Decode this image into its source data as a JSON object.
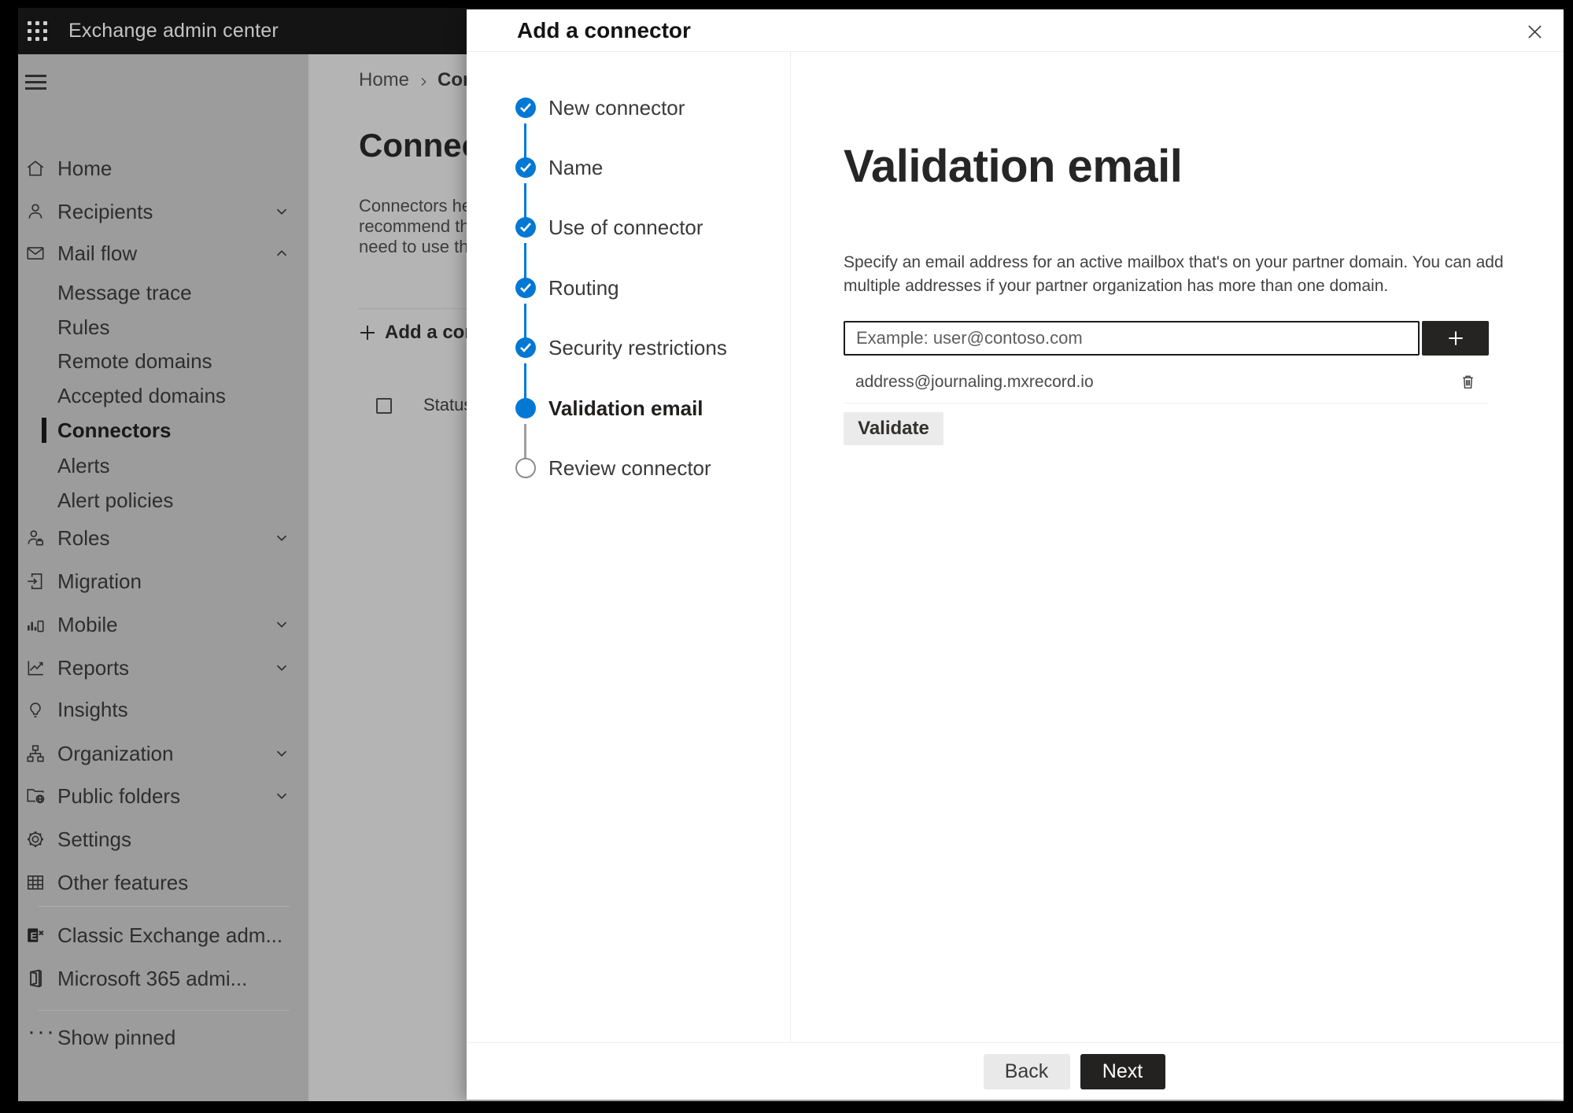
{
  "topbar": {
    "app_title": "Exchange admin center"
  },
  "sidebar": {
    "items": [
      {
        "label": "Home"
      },
      {
        "label": "Recipients"
      },
      {
        "label": "Mail flow"
      },
      {
        "label": "Message trace"
      },
      {
        "label": "Rules"
      },
      {
        "label": "Remote domains"
      },
      {
        "label": "Accepted domains"
      },
      {
        "label": "Connectors"
      },
      {
        "label": "Alerts"
      },
      {
        "label": "Alert policies"
      },
      {
        "label": "Roles"
      },
      {
        "label": "Migration"
      },
      {
        "label": "Mobile"
      },
      {
        "label": "Reports"
      },
      {
        "label": "Insights"
      },
      {
        "label": "Organization"
      },
      {
        "label": "Public folders"
      },
      {
        "label": "Settings"
      },
      {
        "label": "Other features"
      },
      {
        "label": "Classic Exchange adm..."
      },
      {
        "label": "Microsoft 365 admi..."
      },
      {
        "label": "Show pinned"
      }
    ]
  },
  "background": {
    "breadcrumb": {
      "home": "Home",
      "current": "Conne"
    },
    "page_heading": "Connec",
    "intro_lines": [
      "Connectors help",
      "recommend that",
      "need to use ther"
    ],
    "add_connector_label": "Add a conn",
    "status_header": "Status"
  },
  "wizard": {
    "title": "Add a connector",
    "steps": [
      {
        "label": "New connector",
        "state": "completed"
      },
      {
        "label": "Name",
        "state": "completed"
      },
      {
        "label": "Use of connector",
        "state": "completed"
      },
      {
        "label": "Routing",
        "state": "completed"
      },
      {
        "label": "Security restrictions",
        "state": "completed"
      },
      {
        "label": "Validation email",
        "state": "current"
      },
      {
        "label": "Review connector",
        "state": "upcoming"
      }
    ],
    "heading": "Validation email",
    "description": "Specify an email address for an active mailbox that's on your partner domain. You can add multiple addresses if your partner organization has more than one domain.",
    "email_input": {
      "value": "",
      "placeholder": "Example: user@contoso.com"
    },
    "addresses": [
      "address@journaling.mxrecord.io"
    ],
    "validate_label": "Validate",
    "back_label": "Back",
    "next_label": "Next"
  },
  "colors": {
    "accent": "#0078d4",
    "next_button": "#232221",
    "topbar": "#141414"
  }
}
